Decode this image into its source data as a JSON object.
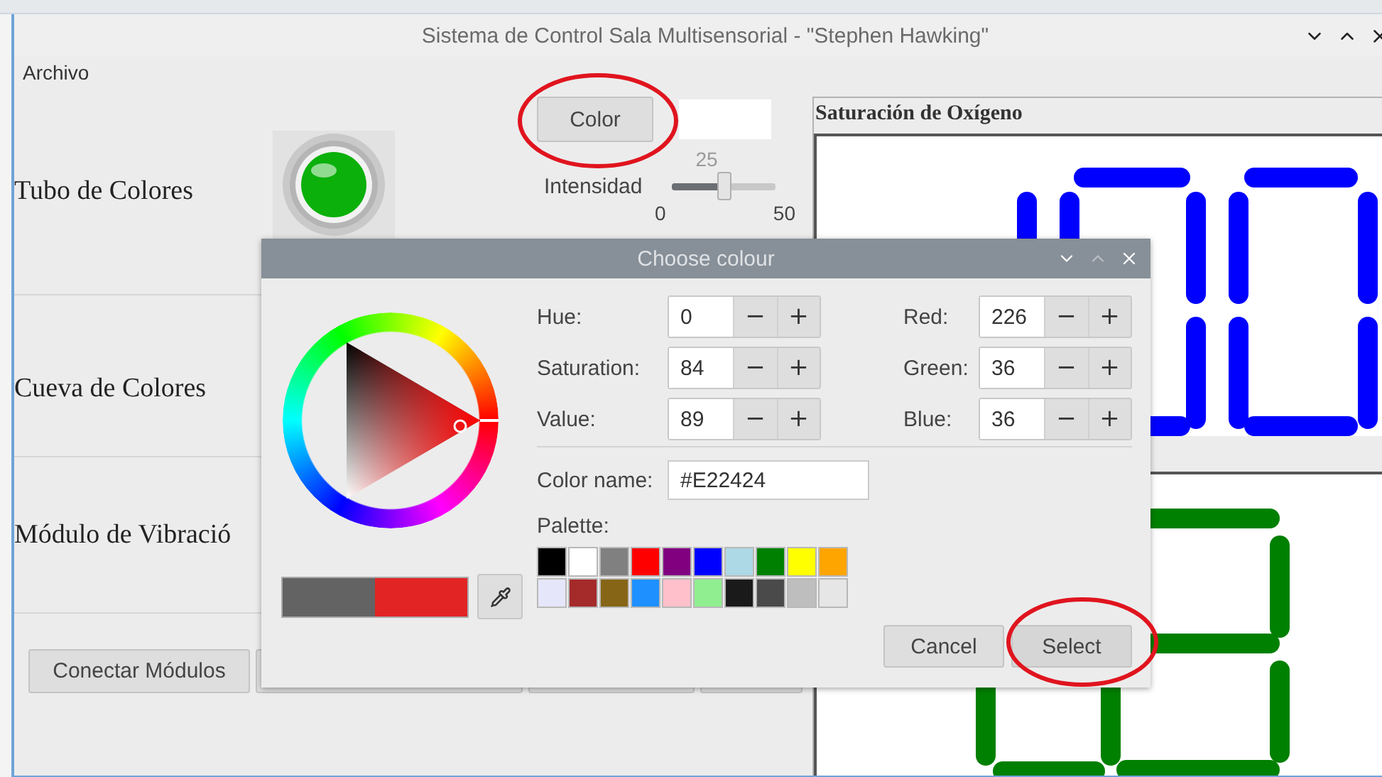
{
  "window": {
    "title": "Sistema de Control Sala Multisensorial - \"Stephen Hawking\""
  },
  "menu": [
    "Archivo"
  ],
  "modules": [
    {
      "label": "Tubo de Colores"
    },
    {
      "label": "Cueva de Colores"
    },
    {
      "label": "Módulo de Vibració"
    }
  ],
  "tube": {
    "color_button": "Color",
    "led": {
      "on": true
    },
    "intensity": {
      "label": "Intensidad",
      "reading": "25",
      "level": 0.5,
      "min": "0",
      "max": "50"
    }
  },
  "buttons": [
    "Conectar Módulos"
  ],
  "oxygen_panel": {
    "title": "Saturación de Oxígeno"
  },
  "dialog": {
    "title": "Choose colour",
    "hsv": [
      {
        "label": "Hue:",
        "value": "0",
        "dec": "−",
        "inc": "+"
      },
      {
        "label": "Saturation:",
        "value": "84",
        "dec": "−",
        "inc": "+"
      },
      {
        "label": "Value:",
        "value": "89",
        "dec": "−",
        "inc": "+"
      }
    ],
    "rgb": [
      {
        "label": "Red:",
        "value": "226",
        "dec": "−",
        "inc": "+"
      },
      {
        "label": "Green:",
        "value": "36",
        "dec": "−",
        "inc": "+"
      },
      {
        "label": "Blue:",
        "value": "36",
        "dec": "−",
        "inc": "+"
      }
    ],
    "color_name": {
      "label": "Color name:",
      "value": "#E22424"
    },
    "palette_label": "Palette:",
    "palette": [
      {
        "color": "#000000"
      },
      {
        "color": "#ffffff"
      },
      {
        "color": "#808080"
      },
      {
        "color": "#ff0000"
      },
      {
        "color": "#800080"
      },
      {
        "color": "#0000ff"
      },
      {
        "color": "#add8e6"
      },
      {
        "color": "#008000"
      },
      {
        "color": "#ffff00"
      },
      {
        "color": "#ffa500"
      },
      {
        "color": "#e6e6fa"
      },
      {
        "color": "#a52a2a"
      },
      {
        "color": "#876516"
      },
      {
        "color": "#1e90ff"
      },
      {
        "color": "#ffc0cb"
      },
      {
        "color": "#90ee90"
      },
      {
        "color": "#1a1a1a"
      },
      {
        "color": "#4a4a4a"
      },
      {
        "color": "#bebebe"
      },
      {
        "color": "#e6e6e6"
      }
    ],
    "preview": [
      {
        "color": "#636363"
      },
      {
        "color": "#e22424"
      }
    ],
    "buttons": [
      "Cancel",
      "Select"
    ]
  }
}
